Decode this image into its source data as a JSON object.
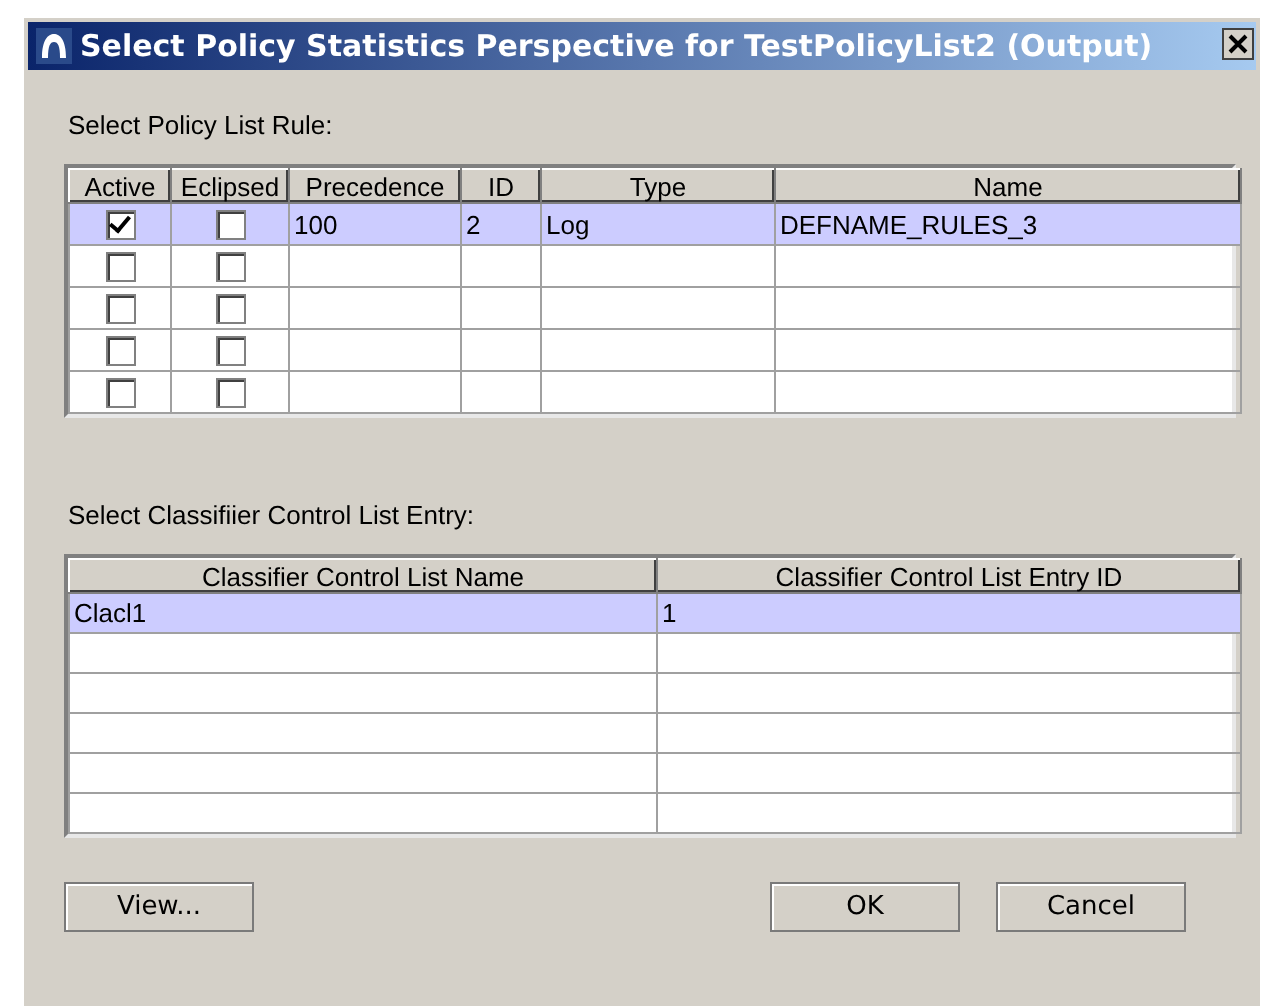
{
  "window": {
    "title": "Select Policy Statistics Perspective for TestPolicyList2 (Output)"
  },
  "rule_section": {
    "label": "Select Policy List Rule:",
    "columns": [
      "Active",
      "Eclipsed",
      "Precedence",
      "ID",
      "Type",
      "Name"
    ],
    "rows": [
      {
        "selected": true,
        "active": true,
        "eclipsed": false,
        "precedence": "100",
        "id": "2",
        "type": "Log",
        "name": "DEFNAME_RULES_3"
      },
      {
        "selected": false,
        "active": false,
        "eclipsed": false
      },
      {
        "selected": false,
        "active": false,
        "eclipsed": false
      },
      {
        "selected": false,
        "active": false,
        "eclipsed": false
      },
      {
        "selected": false,
        "active": false,
        "eclipsed": false
      }
    ]
  },
  "classifier_section": {
    "label": "Select Classifiier Control List Entry:",
    "columns": [
      "Classifier Control List Name",
      "Classifier Control List Entry ID"
    ],
    "rows": [
      {
        "selected": true,
        "name": "Clacl1",
        "entry_id": "1"
      },
      {
        "selected": false
      },
      {
        "selected": false
      },
      {
        "selected": false
      },
      {
        "selected": false
      },
      {
        "selected": false
      }
    ]
  },
  "buttons": [
    {
      "kind": "left",
      "label": "View..."
    },
    {
      "kind": "right",
      "label": "OK"
    },
    {
      "kind": "right",
      "label": "Cancel"
    }
  ]
}
